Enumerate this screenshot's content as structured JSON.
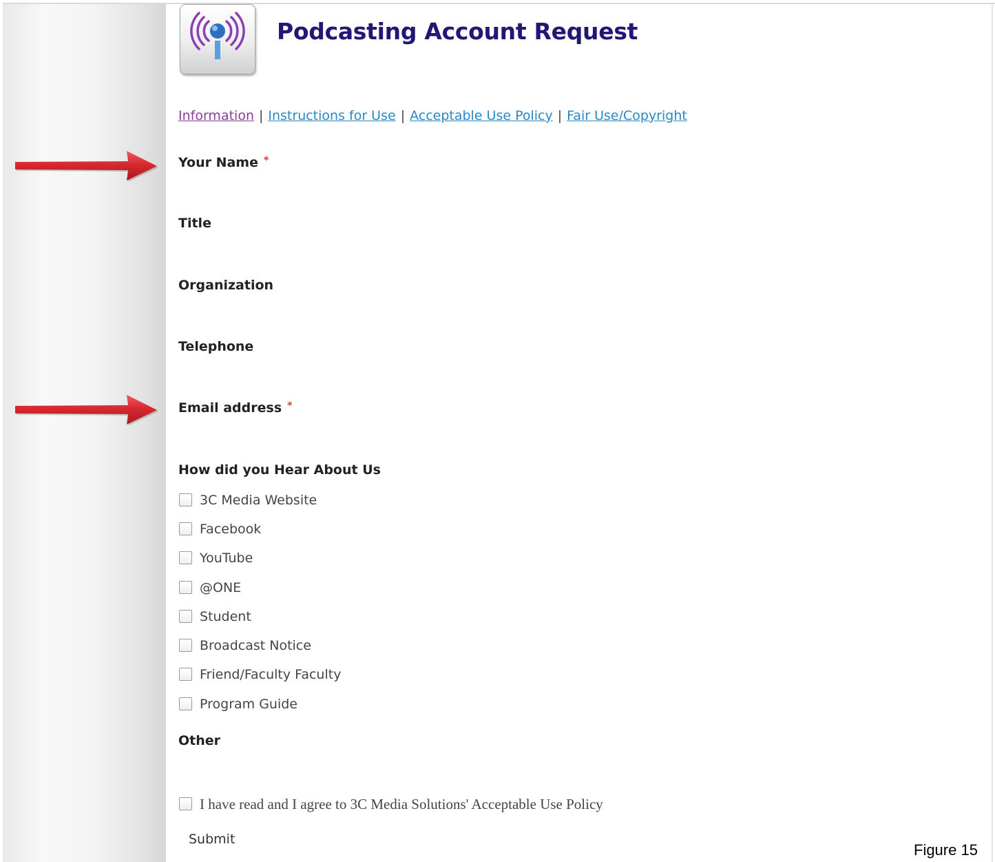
{
  "page": {
    "title": "Podcasting Account Request",
    "logo_icon": "podcast-microphone-icon",
    "accent_color": "#211775"
  },
  "nav": {
    "links": [
      "Information",
      "Instructions for Use",
      "Acceptable Use Policy",
      "Fair Use/Copyright"
    ],
    "separator": "|"
  },
  "form": {
    "required_marker": "*",
    "fields": {
      "name": "Your Name",
      "title": "Title",
      "organization": "Organization",
      "telephone": "Telephone",
      "email": "Email address"
    },
    "hear_about": {
      "heading": "How did you Hear About Us",
      "options": [
        "3C Media Website",
        "Facebook",
        "YouTube",
        "@ONE",
        "Student",
        "Broadcast Notice",
        "Friend/Faculty Faculty",
        "Program Guide"
      ]
    },
    "other_label": "Other",
    "agree_label": "I have read and I agree to 3C Media Solutions' Acceptable Use Policy",
    "submit_label": "Submit"
  },
  "annotations": {
    "arrow_color": "#d7282f",
    "arrow_icon": "red-arrow-right-icon"
  },
  "caption": "Figure 15"
}
